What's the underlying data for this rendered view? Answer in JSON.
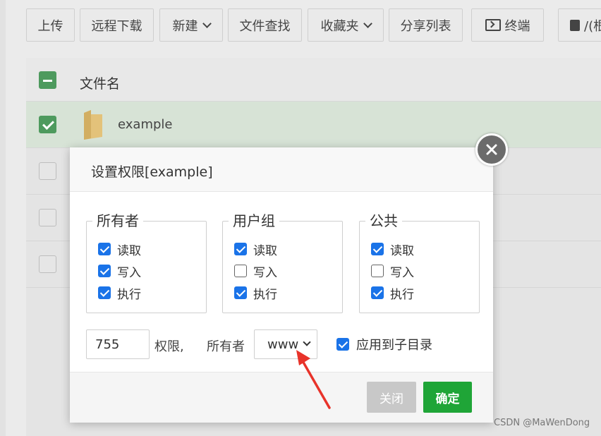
{
  "toolbar": {
    "upload": "上传",
    "remote_download": "远程下载",
    "new": "新建",
    "file_search": "文件查找",
    "favorites": "收藏夹",
    "share_list": "分享列表",
    "terminal": "终端",
    "path": "/(根"
  },
  "file_table": {
    "header": "文件名",
    "rows": [
      {
        "name": "example",
        "selected": true
      },
      {
        "name": "",
        "selected": false
      },
      {
        "name": "",
        "selected": false
      },
      {
        "name": "",
        "selected": false
      }
    ]
  },
  "dialog": {
    "title": "设置权限[example]",
    "groups": [
      {
        "legend": "所有者",
        "perms": [
          {
            "label": "读取",
            "checked": true
          },
          {
            "label": "写入",
            "checked": true
          },
          {
            "label": "执行",
            "checked": true
          }
        ]
      },
      {
        "legend": "用户组",
        "perms": [
          {
            "label": "读取",
            "checked": true
          },
          {
            "label": "写入",
            "checked": false
          },
          {
            "label": "执行",
            "checked": true
          }
        ]
      },
      {
        "legend": "公共",
        "perms": [
          {
            "label": "读取",
            "checked": true
          },
          {
            "label": "写入",
            "checked": false
          },
          {
            "label": "执行",
            "checked": true
          }
        ]
      }
    ],
    "mode_value": "755",
    "mode_label": "权限,",
    "owner_label": "所有者",
    "owner_value": "www",
    "apply_subdirs": {
      "label": "应用到子目录",
      "checked": true
    },
    "close_label": "关闭",
    "confirm_label": "确定"
  },
  "watermark": "CSDN @MaWenDong",
  "colors": {
    "confirm": "#1fa537",
    "checkbox": "#1a73e8",
    "annotation_arrow": "#e8332a"
  }
}
